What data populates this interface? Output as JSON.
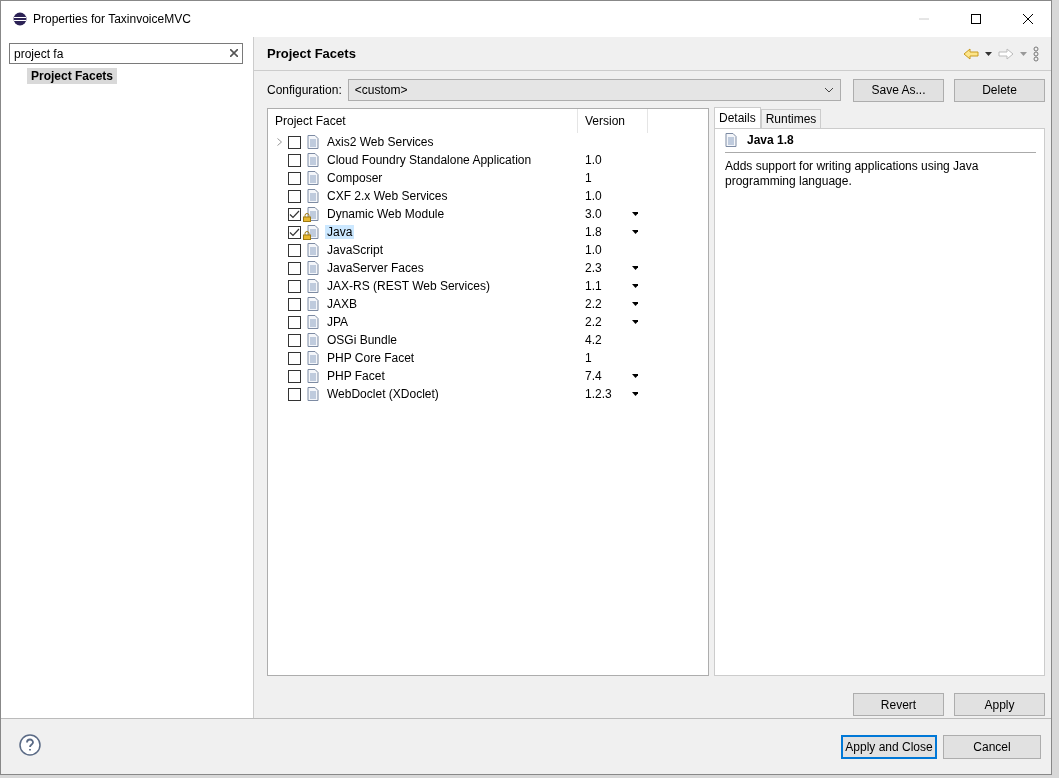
{
  "window": {
    "title": "Properties for TaxinvoiceMVC"
  },
  "sidebar": {
    "search": {
      "value": "project fa"
    },
    "items": [
      {
        "label": "Project Facets",
        "selected": true
      }
    ]
  },
  "page": {
    "title": "Project Facets"
  },
  "configuration": {
    "label": "Configuration:",
    "value": "<custom>",
    "buttons": [
      "Save As...",
      "Delete"
    ]
  },
  "facets_table": {
    "columns": [
      "Project Facet",
      "Version"
    ],
    "rows": [
      {
        "name": "Axis2 Web Services",
        "version": "",
        "checked": false,
        "locked": false,
        "selected": false,
        "expandable": true,
        "version_menu": false
      },
      {
        "name": "Cloud Foundry Standalone Application",
        "version": "1.0",
        "checked": false,
        "locked": false,
        "selected": false,
        "expandable": false,
        "version_menu": false
      },
      {
        "name": "Composer",
        "version": "1",
        "checked": false,
        "locked": false,
        "selected": false,
        "expandable": false,
        "version_menu": false
      },
      {
        "name": "CXF 2.x Web Services",
        "version": "1.0",
        "checked": false,
        "locked": false,
        "selected": false,
        "expandable": false,
        "version_menu": false
      },
      {
        "name": "Dynamic Web Module",
        "version": "3.0",
        "checked": true,
        "locked": true,
        "selected": false,
        "expandable": false,
        "version_menu": true
      },
      {
        "name": "Java",
        "version": "1.8",
        "checked": true,
        "locked": true,
        "selected": true,
        "expandable": false,
        "version_menu": true
      },
      {
        "name": "JavaScript",
        "version": "1.0",
        "checked": false,
        "locked": false,
        "selected": false,
        "expandable": false,
        "version_menu": false
      },
      {
        "name": "JavaServer Faces",
        "version": "2.3",
        "checked": false,
        "locked": false,
        "selected": false,
        "expandable": false,
        "version_menu": true
      },
      {
        "name": "JAX-RS (REST Web Services)",
        "version": "1.1",
        "checked": false,
        "locked": false,
        "selected": false,
        "expandable": false,
        "version_menu": true
      },
      {
        "name": "JAXB",
        "version": "2.2",
        "checked": false,
        "locked": false,
        "selected": false,
        "expandable": false,
        "version_menu": true
      },
      {
        "name": "JPA",
        "version": "2.2",
        "checked": false,
        "locked": false,
        "selected": false,
        "expandable": false,
        "version_menu": true
      },
      {
        "name": "OSGi Bundle",
        "version": "4.2",
        "checked": false,
        "locked": false,
        "selected": false,
        "expandable": false,
        "version_menu": false
      },
      {
        "name": "PHP Core Facet",
        "version": "1",
        "checked": false,
        "locked": false,
        "selected": false,
        "expandable": false,
        "version_menu": false
      },
      {
        "name": "PHP Facet",
        "version": "7.4",
        "checked": false,
        "locked": false,
        "selected": false,
        "expandable": false,
        "version_menu": true
      },
      {
        "name": "WebDoclet (XDoclet)",
        "version": "1.2.3",
        "checked": false,
        "locked": false,
        "selected": false,
        "expandable": false,
        "version_menu": true
      }
    ]
  },
  "details": {
    "tabs": [
      {
        "label": "Details",
        "selected": true
      },
      {
        "label": "Runtimes",
        "selected": false
      }
    ],
    "heading": "Java 1.8",
    "description": "Adds support for writing applications using Java programming language."
  },
  "page_buttons": [
    "Revert",
    "Apply"
  ],
  "footer_buttons": [
    {
      "label": "Apply and Close",
      "default": true
    },
    {
      "label": "Cancel",
      "default": false
    }
  ]
}
